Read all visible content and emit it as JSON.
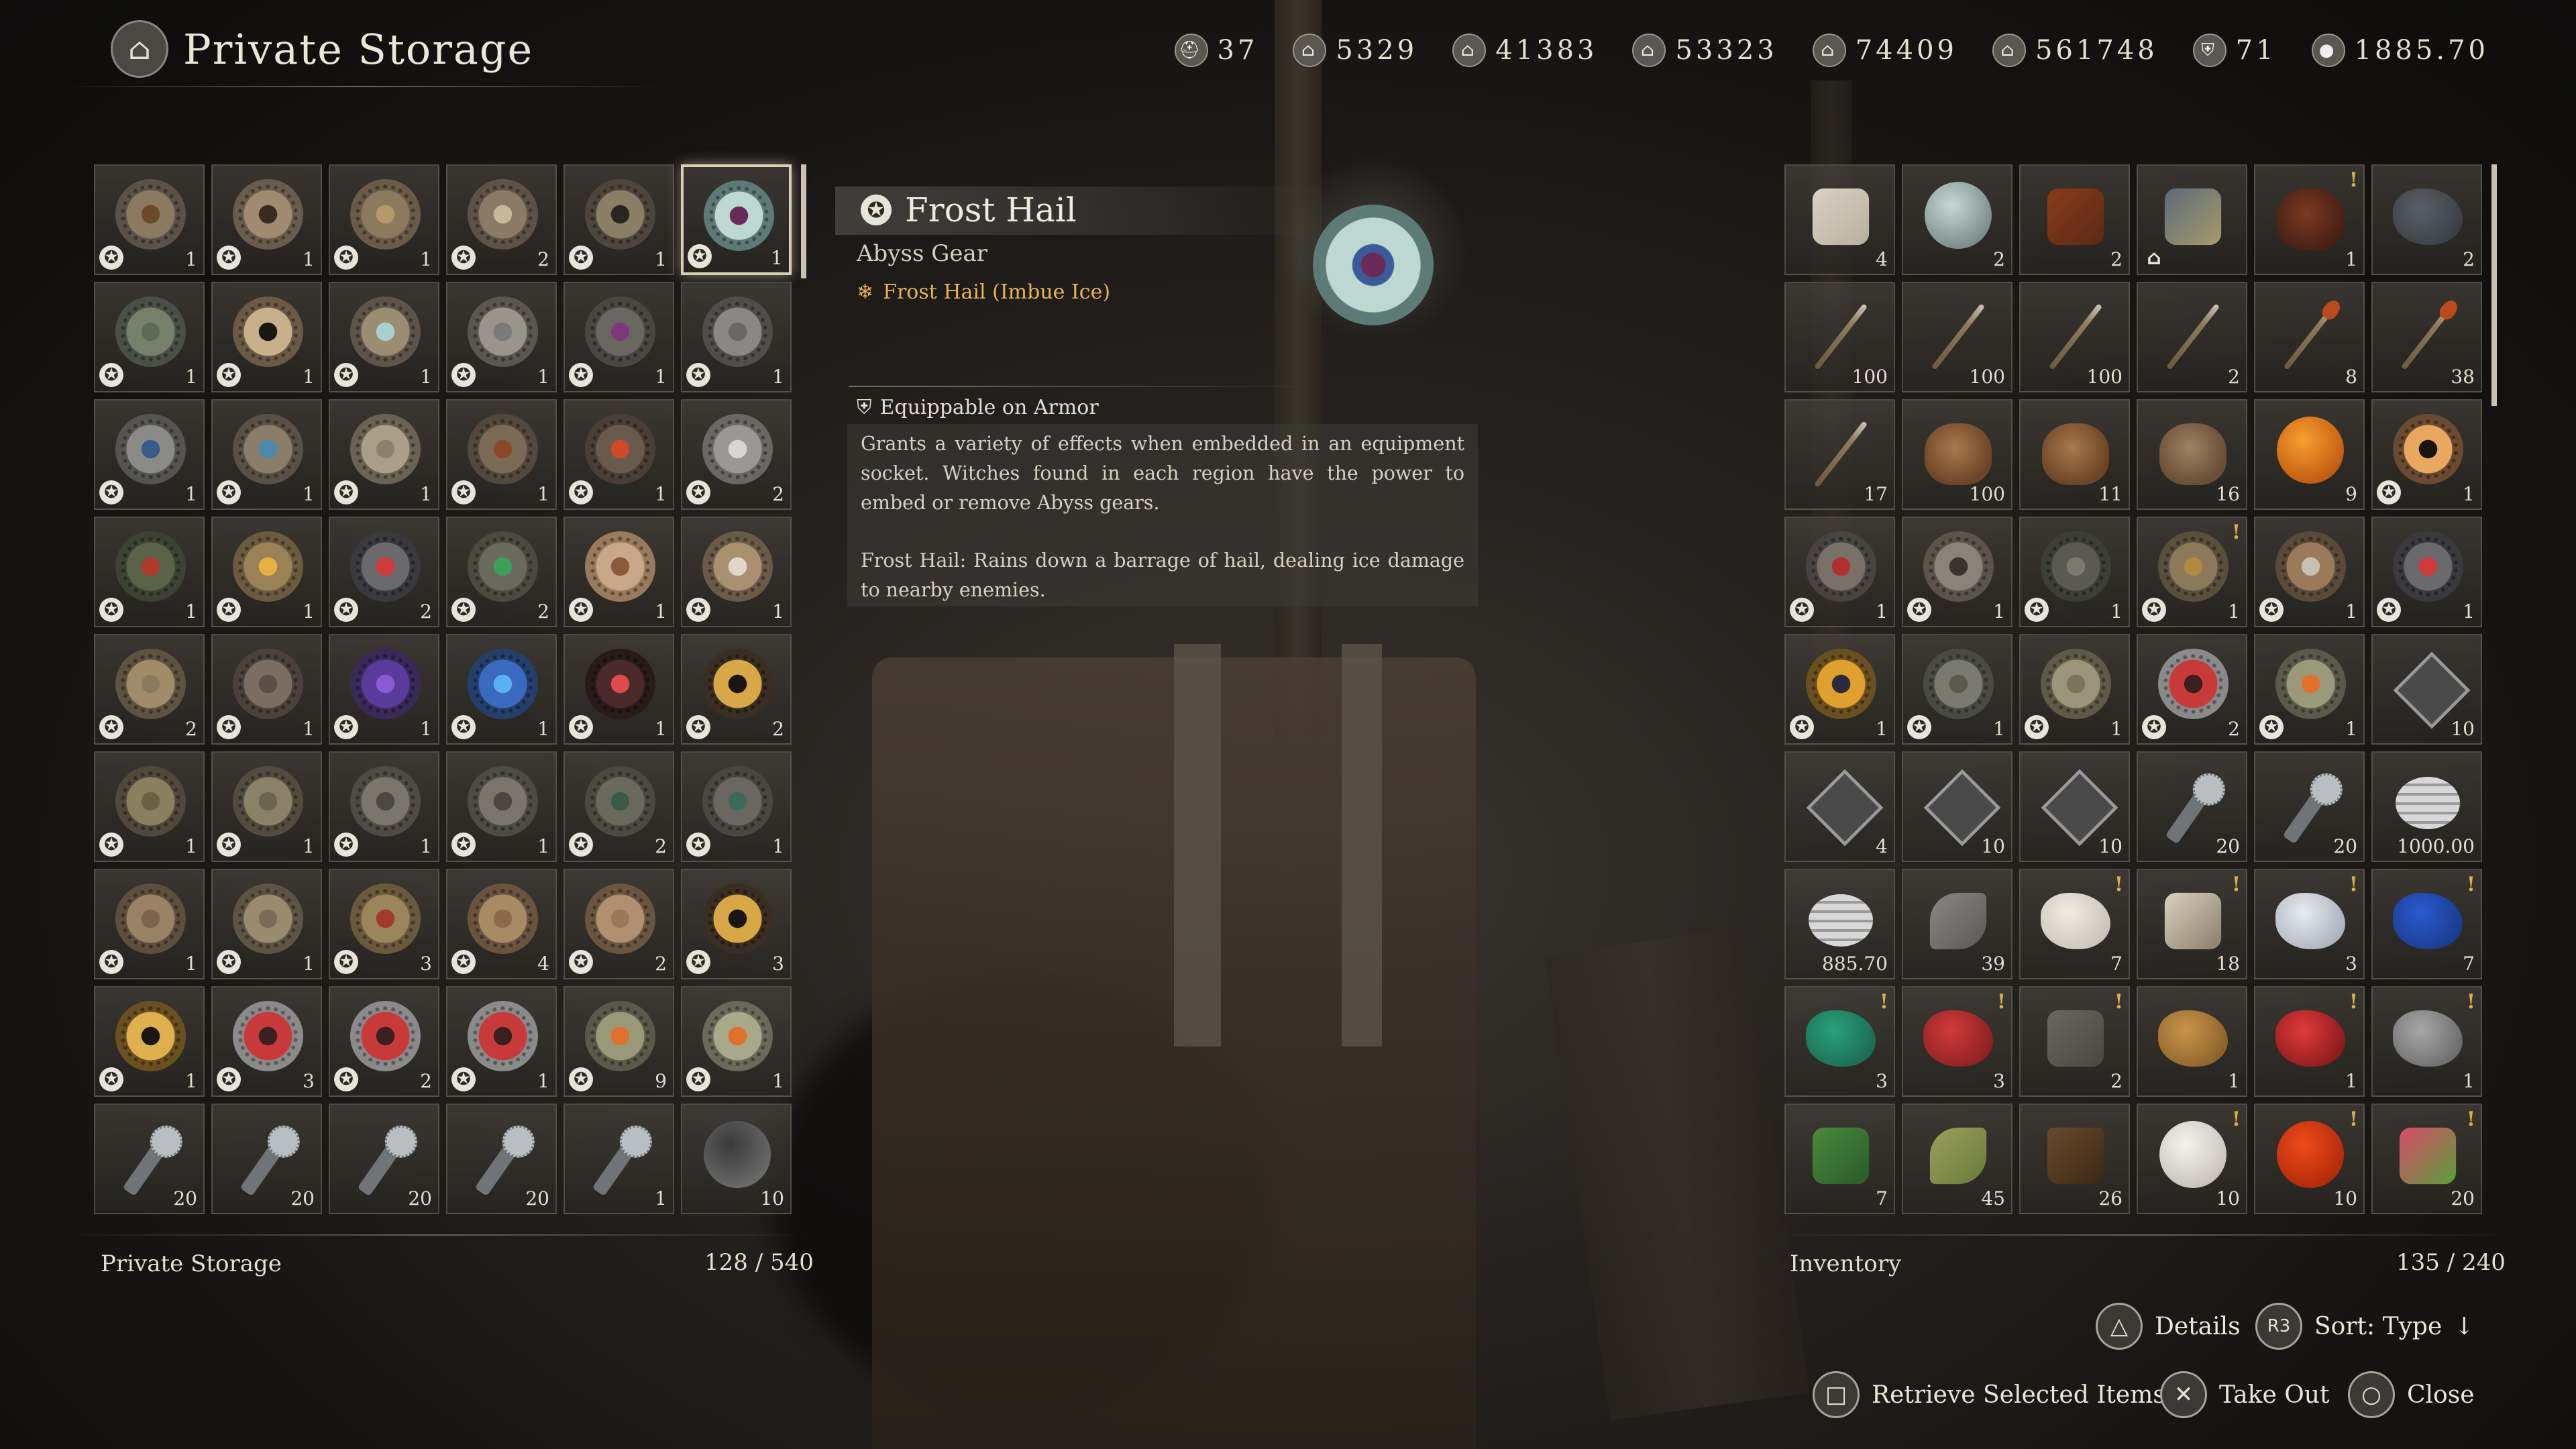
{
  "header": {
    "title": "Private Storage",
    "title_icon": "storage-chest-icon",
    "stats": [
      {
        "icon": "helmet-icon",
        "value": "37"
      },
      {
        "icon": "camp-resource-icon",
        "value": "5329"
      },
      {
        "icon": "lumber-icon",
        "value": "41383"
      },
      {
        "icon": "ore-icon",
        "value": "53323"
      },
      {
        "icon": "cloth-icon",
        "value": "74409"
      },
      {
        "icon": "food-icon",
        "value": "561748"
      },
      {
        "icon": "crest-icon",
        "value": "71"
      },
      {
        "icon": "silver-coin-icon",
        "value": "1885.70"
      }
    ]
  },
  "storage": {
    "label": "Private Storage",
    "capacity": "128 / 540",
    "items": [
      {
        "kind": "gear",
        "colors": [
          "#6b4a2a",
          "#8a7a62",
          "#5a5248"
        ],
        "abyss": true,
        "count": "1"
      },
      {
        "kind": "gear",
        "colors": [
          "#3a2a20",
          "#a08a70",
          "#6a5c4c"
        ],
        "abyss": true,
        "count": "1"
      },
      {
        "kind": "gear",
        "colors": [
          "#b89a6a",
          "#8c7a5e",
          "#6a5a48"
        ],
        "abyss": true,
        "count": "1"
      },
      {
        "kind": "gear",
        "colors": [
          "#c8b89a",
          "#8a7a66",
          "#5e5246"
        ],
        "abyss": true,
        "count": "2"
      },
      {
        "kind": "gear",
        "colors": [
          "#2a2520",
          "#8a7e66",
          "#4e463c"
        ],
        "abyss": true,
        "count": "1"
      },
      {
        "kind": "gear",
        "colors": [
          "#6a2a5a",
          "#bcd8d0",
          "#5c7a76"
        ],
        "abyss": true,
        "count": "1",
        "selected": true
      },
      {
        "kind": "gear",
        "colors": [
          "#5e6a58",
          "#76806a",
          "#4a5046"
        ],
        "abyss": true,
        "count": "1"
      },
      {
        "kind": "gear",
        "colors": [
          "#1a1612",
          "#c8b08a",
          "#6a5a46"
        ],
        "abyss": true,
        "count": "1"
      },
      {
        "kind": "gear",
        "colors": [
          "#a8d0d0",
          "#9c8c72",
          "#5e544a"
        ],
        "abyss": true,
        "count": "1"
      },
      {
        "kind": "gear",
        "colors": [
          "#7a7a78",
          "#9a948a",
          "#5a5650"
        ],
        "abyss": true,
        "count": "1"
      },
      {
        "kind": "gear",
        "colors": [
          "#7a3a7a",
          "#6a6660",
          "#4a4640"
        ],
        "abyss": true,
        "count": "1"
      },
      {
        "kind": "gear",
        "colors": [
          "#6a6866",
          "#8a8884",
          "#504e4a"
        ],
        "abyss": true,
        "count": "1"
      },
      {
        "kind": "gear",
        "colors": [
          "#3a5a8a",
          "#8a8a86",
          "#565450"
        ],
        "abyss": true,
        "count": "1"
      },
      {
        "kind": "gear",
        "colors": [
          "#4a8ab0",
          "#8a7e6a",
          "#5a5046"
        ],
        "abyss": true,
        "count": "1"
      },
      {
        "kind": "gear",
        "colors": [
          "#8a8270",
          "#aaa08a",
          "#6a6252"
        ],
        "abyss": true,
        "count": "1"
      },
      {
        "kind": "gear",
        "colors": [
          "#8a4a2a",
          "#7a6a56",
          "#54483c"
        ],
        "abyss": true,
        "count": "1"
      },
      {
        "kind": "gear",
        "colors": [
          "#d04a2a",
          "#6a5a4e",
          "#4a3e36"
        ],
        "abyss": true,
        "count": "1"
      },
      {
        "kind": "gear",
        "colors": [
          "#d8d6d2",
          "#9a9894",
          "#6a6864"
        ],
        "abyss": true,
        "count": "2"
      },
      {
        "kind": "gear",
        "colors": [
          "#b03a2a",
          "#5a6248",
          "#3e4232"
        ],
        "abyss": true,
        "count": "1"
      },
      {
        "kind": "gear",
        "colors": [
          "#e8b040",
          "#9a8256",
          "#6a5a3e"
        ],
        "abyss": true,
        "count": "1"
      },
      {
        "kind": "gear",
        "colors": [
          "#d03a3a",
          "#6a6a6c",
          "#3a3a3e"
        ],
        "abyss": true,
        "count": "2"
      },
      {
        "kind": "gear",
        "colors": [
          "#3aa05a",
          "#6a6a5c",
          "#4a4a40"
        ],
        "abyss": true,
        "count": "2"
      },
      {
        "kind": "gear",
        "colors": [
          "#8a5a3a",
          "#c8a888",
          "#9a7a5c"
        ],
        "abyss": true,
        "count": "1"
      },
      {
        "kind": "gear",
        "colors": [
          "#e0d8cc",
          "#a89070",
          "#6a5a48"
        ],
        "abyss": true,
        "count": "1"
      },
      {
        "kind": "gear",
        "colors": [
          "#8a7a5e",
          "#a08c6a",
          "#5e5240"
        ],
        "abyss": true,
        "count": "2"
      },
      {
        "kind": "gear",
        "colors": [
          "#5a5048",
          "#7a6e62",
          "#4a423a"
        ],
        "abyss": true,
        "count": "1"
      },
      {
        "kind": "gear",
        "colors": [
          "#8a5ad0",
          "#5a3a9a",
          "#3a2a5a"
        ],
        "abyss": true,
        "count": "1"
      },
      {
        "kind": "gear",
        "colors": [
          "#5ab0f0",
          "#3a6ac0",
          "#24406a"
        ],
        "abyss": true,
        "count": "1"
      },
      {
        "kind": "gear",
        "colors": [
          "#e04a4a",
          "#4a2a2a",
          "#2a1a1a"
        ],
        "abyss": true,
        "count": "1"
      },
      {
        "kind": "gear",
        "colors": [
          "#1a1614",
          "#d8a848",
          "#3a2e22"
        ],
        "abyss": true,
        "count": "2"
      },
      {
        "kind": "gear",
        "colors": [
          "#6a6044",
          "#8a8060",
          "#50483a"
        ],
        "abyss": true,
        "count": "1"
      },
      {
        "kind": "gear",
        "colors": [
          "#6a6450",
          "#8a8266",
          "#524c3e"
        ],
        "abyss": true,
        "count": "1"
      },
      {
        "kind": "gear",
        "colors": [
          "#4a4844",
          "#7a766e",
          "#4e4a44"
        ],
        "abyss": true,
        "count": "1"
      },
      {
        "kind": "gear",
        "colors": [
          "#4a4642",
          "#7a746c",
          "#4e4a44"
        ],
        "abyss": true,
        "count": "1"
      },
      {
        "kind": "gear",
        "colors": [
          "#3a5a4a",
          "#6a6a5c",
          "#4a4a40"
        ],
        "abyss": true,
        "count": "2"
      },
      {
        "kind": "gear",
        "colors": [
          "#3a6a5a",
          "#6a6660",
          "#4a4640"
        ],
        "abyss": true,
        "count": "1"
      },
      {
        "kind": "gear",
        "colors": [
          "#7a6450",
          "#9a8264",
          "#5e4e3e"
        ],
        "abyss": true,
        "count": "1"
      },
      {
        "kind": "gear",
        "colors": [
          "#7a6a56",
          "#9a8a6e",
          "#5e5444"
        ],
        "abyss": true,
        "count": "1"
      },
      {
        "kind": "gear",
        "colors": [
          "#a03a2a",
          "#9a865a",
          "#6a5a3c"
        ],
        "abyss": true,
        "count": "3"
      },
      {
        "kind": "gear",
        "colors": [
          "#8a6a4a",
          "#a88a64",
          "#6a5440"
        ],
        "abyss": true,
        "count": "4"
      },
      {
        "kind": "gear",
        "colors": [
          "#9a7a56",
          "#b09070",
          "#6a5640"
        ],
        "abyss": true,
        "count": "2"
      },
      {
        "kind": "gear",
        "colors": [
          "#1a1614",
          "#d8a848",
          "#3a2e22"
        ],
        "abyss": true,
        "count": "3"
      },
      {
        "kind": "gear",
        "colors": [
          "#1a1614",
          "#e0b050",
          "#6a5020"
        ],
        "abyss": true,
        "count": "1"
      },
      {
        "kind": "gear",
        "colors": [
          "#3a2020",
          "#c83a3a",
          "#8a8a8a"
        ],
        "abyss": true,
        "count": "3"
      },
      {
        "kind": "gear",
        "colors": [
          "#3a2020",
          "#c83a3a",
          "#8a8a8a"
        ],
        "abyss": true,
        "count": "2"
      },
      {
        "kind": "gear",
        "colors": [
          "#3a2020",
          "#c83a3a",
          "#8a8a8a"
        ],
        "abyss": true,
        "count": "1"
      },
      {
        "kind": "gear",
        "colors": [
          "#e0702a",
          "#9a9a7a",
          "#5a5a4a"
        ],
        "abyss": true,
        "count": "9"
      },
      {
        "kind": "gear",
        "colors": [
          "#e0702a",
          "#a8a88a",
          "#6a6a5a"
        ],
        "abyss": true,
        "count": "1"
      },
      {
        "kind": "mace",
        "count": "20"
      },
      {
        "kind": "mace",
        "count": "20"
      },
      {
        "kind": "mace",
        "count": "20"
      },
      {
        "kind": "mace",
        "count": "20"
      },
      {
        "kind": "mace",
        "count": "1"
      },
      {
        "kind": "orb",
        "colors": [
          "#3a3a3a",
          "#6a6a6a"
        ],
        "count": "10"
      }
    ]
  },
  "detail": {
    "name": "Frost Hail",
    "category": "Abyss Gear",
    "effect": "Frost Hail (Imbue Ice)",
    "effect_icon": "snowflake-icon",
    "equip": "Equippable on Armor",
    "equip_icon": "armor-icon",
    "description_1": "Grants a variety of effects when embedded in an equipment socket. Witches found in each region have the power to embed or remove Abyss gears.",
    "description_2": "Frost Hail: Rains down a barrage of hail, dealing ice damage to nearby enemies."
  },
  "inventory": {
    "label": "Inventory",
    "capacity": "135 / 240",
    "items": [
      {
        "kind": "shape",
        "shape": "cloth",
        "colors": [
          "#d8d2c4",
          "#b8b0a0"
        ],
        "count": "4"
      },
      {
        "kind": "orb",
        "colors": [
          "#c8d8d4",
          "#7a8a88"
        ],
        "count": "2"
      },
      {
        "kind": "shape",
        "shape": "stick-red",
        "colors": [
          "#8a3a1a",
          "#5a2a14"
        ],
        "count": "2"
      },
      {
        "kind": "shape",
        "shape": "house",
        "colors": [
          "#5a6a7a",
          "#a89a6a"
        ],
        "count": ""
      },
      {
        "kind": "pouch",
        "colors": [
          "#7a3a22",
          "#4a2014"
        ],
        "count": "1",
        "alert": true
      },
      {
        "kind": "rock",
        "colors": [
          "#5a5e66",
          "#3a3e44"
        ],
        "count": "2"
      },
      {
        "kind": "stick",
        "count": "100"
      },
      {
        "kind": "stick",
        "count": "100"
      },
      {
        "kind": "stick",
        "count": "100"
      },
      {
        "kind": "stick",
        "count": "2"
      },
      {
        "kind": "stick",
        "variant": "red",
        "count": "8"
      },
      {
        "kind": "stick",
        "variant": "red",
        "count": "38"
      },
      {
        "kind": "stick",
        "count": "17"
      },
      {
        "kind": "pouch",
        "colors": [
          "#a9794e",
          "#6d4526"
        ],
        "count": "100"
      },
      {
        "kind": "pouch",
        "colors": [
          "#a9794e",
          "#6d4526"
        ],
        "count": "11"
      },
      {
        "kind": "pouch",
        "colors": [
          "#a08264",
          "#6a4e36"
        ],
        "count": "16"
      },
      {
        "kind": "orb",
        "colors": [
          "#f8a030",
          "#c05a10"
        ],
        "count": "9"
      },
      {
        "kind": "gear",
        "colors": [
          "#1a1410",
          "#e8a860",
          "#6a4a30"
        ],
        "abyss": true,
        "count": "1"
      },
      {
        "kind": "gear",
        "colors": [
          "#b03030",
          "#7a706a",
          "#4a4440"
        ],
        "abyss": true,
        "count": "1"
      },
      {
        "kind": "gear",
        "colors": [
          "#3a3430",
          "#8a8478",
          "#5a544c"
        ],
        "abyss": true,
        "count": "1"
      },
      {
        "kind": "gear",
        "colors": [
          "#7a7a70",
          "#5a5a52",
          "#3e3e38"
        ],
        "abyss": true,
        "count": "1"
      },
      {
        "kind": "gear",
        "colors": [
          "#b08a40",
          "#8a7a5a",
          "#5a4e3c"
        ],
        "abyss": true,
        "count": "1",
        "alert": true
      },
      {
        "kind": "gear",
        "colors": [
          "#c8c0b0",
          "#9a7a5a",
          "#5a4a3a"
        ],
        "abyss": true,
        "count": "1"
      },
      {
        "kind": "gear",
        "colors": [
          "#d03a3a",
          "#6a6a6c",
          "#3a3a3e"
        ],
        "abyss": true,
        "count": "1"
      },
      {
        "kind": "gear",
        "colors": [
          "#2a2a3a",
          "#e0a030",
          "#6a5020"
        ],
        "abyss": true,
        "count": "1"
      },
      {
        "kind": "gear",
        "colors": [
          "#5a5a52",
          "#7a7a70",
          "#4a4a44"
        ],
        "abyss": true,
        "count": "1"
      },
      {
        "kind": "gear",
        "colors": [
          "#7a745e",
          "#9a9478",
          "#5e5a48"
        ],
        "abyss": true,
        "count": "1"
      },
      {
        "kind": "gear",
        "colors": [
          "#3a2020",
          "#c83a3a",
          "#8a8a8a"
        ],
        "abyss": true,
        "count": "2"
      },
      {
        "kind": "gear",
        "colors": [
          "#e0702a",
          "#9a9a7a",
          "#5a5a4a"
        ],
        "abyss": true,
        "count": "1"
      },
      {
        "kind": "cube",
        "count": "10"
      },
      {
        "kind": "cube",
        "count": "4"
      },
      {
        "kind": "cube",
        "count": "10"
      },
      {
        "kind": "cube",
        "count": "10"
      },
      {
        "kind": "mace",
        "count": "20"
      },
      {
        "kind": "mace",
        "count": "20"
      },
      {
        "kind": "coin",
        "count": "1000.00"
      },
      {
        "kind": "coin",
        "count": "885.70"
      },
      {
        "kind": "shape",
        "shape": "feather",
        "colors": [
          "#8a8884",
          "#5a5854"
        ],
        "count": "39"
      },
      {
        "kind": "rock",
        "colors": [
          "#f0ece4",
          "#c8c2b6"
        ],
        "count": "7",
        "alert": true
      },
      {
        "kind": "shape",
        "shape": "bandage",
        "colors": [
          "#d8d0c0",
          "#8a7e6a"
        ],
        "count": "18",
        "alert": true
      },
      {
        "kind": "rock",
        "colors": [
          "#e8ecf0",
          "#a8b0b8"
        ],
        "count": "3",
        "alert": true
      },
      {
        "kind": "rock",
        "colors": [
          "#2a5ad0",
          "#1a3a8a"
        ],
        "count": "7",
        "alert": true
      },
      {
        "kind": "rock",
        "colors": [
          "#2aa07a",
          "#1a6a52"
        ],
        "count": "3",
        "alert": true
      },
      {
        "kind": "rock",
        "colors": [
          "#d03a3a",
          "#8a2020"
        ],
        "count": "3",
        "alert": true
      },
      {
        "kind": "shape",
        "shape": "slab",
        "colors": [
          "#6a6660",
          "#4a4640"
        ],
        "count": "2",
        "alert": true
      },
      {
        "kind": "rock",
        "colors": [
          "#c8944a",
          "#8a6028"
        ],
        "count": "1"
      },
      {
        "kind": "rock",
        "colors": [
          "#e03a3a",
          "#8a1a1a"
        ],
        "count": "1",
        "alert": true
      },
      {
        "kind": "rock",
        "colors": [
          "#a8a8a8",
          "#6a6a6a"
        ],
        "count": "1",
        "alert": true
      },
      {
        "kind": "shape",
        "shape": "plant",
        "colors": [
          "#4a8a3a",
          "#2a5a2a"
        ],
        "count": "7"
      },
      {
        "kind": "shape",
        "shape": "wheat",
        "colors": [
          "#9aa05a",
          "#6a7a3a"
        ],
        "count": "45"
      },
      {
        "kind": "shape",
        "shape": "mug",
        "colors": [
          "#6a4a2a",
          "#3a2814"
        ],
        "count": "26"
      },
      {
        "kind": "orb",
        "colors": [
          "#f4f2ee",
          "#c8c4bc"
        ],
        "count": "10",
        "alert": true
      },
      {
        "kind": "orb",
        "colors": [
          "#f04a1a",
          "#b02a0a"
        ],
        "count": "10",
        "alert": true
      },
      {
        "kind": "shape",
        "shape": "radish",
        "colors": [
          "#d84a6a",
          "#5aa03a"
        ],
        "count": "20",
        "alert": true
      }
    ]
  },
  "controls": {
    "details": {
      "icon": "triangle-button-icon",
      "glyph": "△",
      "label": "Details"
    },
    "sort": {
      "icon": "r3-button-icon",
      "glyph": "R3",
      "label": "Sort: Type"
    },
    "retrieve": {
      "icon": "square-button-icon",
      "glyph": "□",
      "label": "Retrieve Selected Items"
    },
    "take_out": {
      "icon": "cross-button-icon",
      "glyph": "✕",
      "label": "Take Out"
    },
    "close": {
      "icon": "circle-button-icon",
      "glyph": "○",
      "label": "Close"
    }
  }
}
